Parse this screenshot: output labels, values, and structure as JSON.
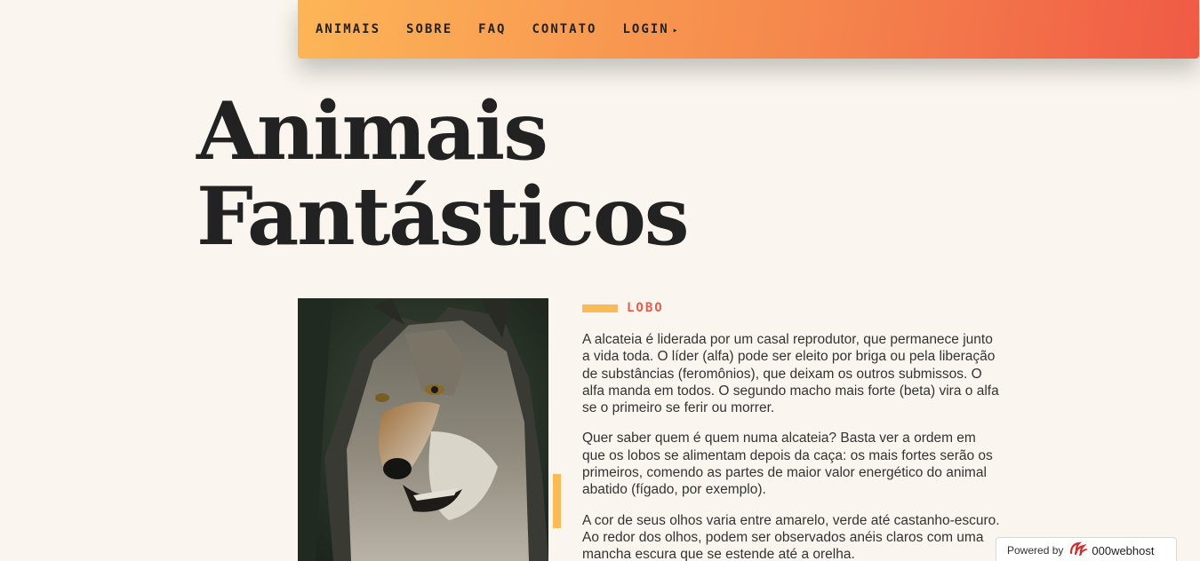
{
  "nav": {
    "items": [
      {
        "label": "ANIMAIS"
      },
      {
        "label": "SOBRE"
      },
      {
        "label": "FAQ"
      },
      {
        "label": "CONTATO"
      },
      {
        "label": "LOGIN"
      }
    ],
    "login_arrow": "▸"
  },
  "hero": {
    "title_line1": "Animais",
    "title_line2": "Fantásticos"
  },
  "animal": {
    "name": "LOBO",
    "paragraphs": [
      "A alcateia é liderada por um casal reprodutor, que permanece junto a vida toda. O líder (alfa) pode ser eleito por briga ou pela liberação de substâncias (feromônios), que deixam os outros submissos. O alfa manda em todos. O segundo macho mais forte (beta) vira o alfa se o primeiro se ferir ou morrer.",
      "Quer saber quem é quem numa alcateia? Basta ver a ordem em que os lobos se alimentam depois da caça: os mais fortes serão os primeiros, comendo as partes de maior valor energético do animal abatido (fígado, por exemplo).",
      "A cor de seus olhos varia entre amarelo, verde até castanho-escuro. Ao redor dos olhos, podem ser observados anéis claros com uma mancha escura que se estende até a orelha."
    ]
  },
  "footer_badge": {
    "label": "Powered by",
    "brand": "000webhost"
  },
  "colors": {
    "background": "#faf6ef",
    "nav_gradient_start": "#fdb557",
    "nav_gradient_end": "#f05a45",
    "accent_yellow": "#f9bb56",
    "accent_red": "#e95a48",
    "text": "#222222"
  }
}
